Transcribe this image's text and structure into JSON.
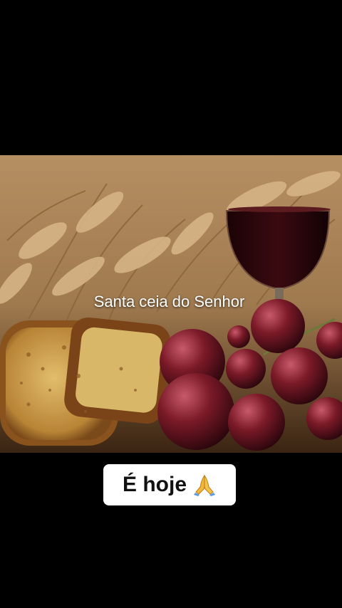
{
  "image": {
    "overlay_text": "Santa ceia do Senhor",
    "subjects": [
      "wheat-icon",
      "wine-glass-icon",
      "bread-icon",
      "grapes-icon"
    ]
  },
  "caption": {
    "text": "É hoje",
    "emoji": "praying-hands-icon"
  },
  "colors": {
    "background": "#000000",
    "caption_bg": "#ffffff",
    "wine": "#2a0608",
    "grape": "#7a1a24",
    "bread": "#c89a4a",
    "wheat": "#c9a274"
  }
}
